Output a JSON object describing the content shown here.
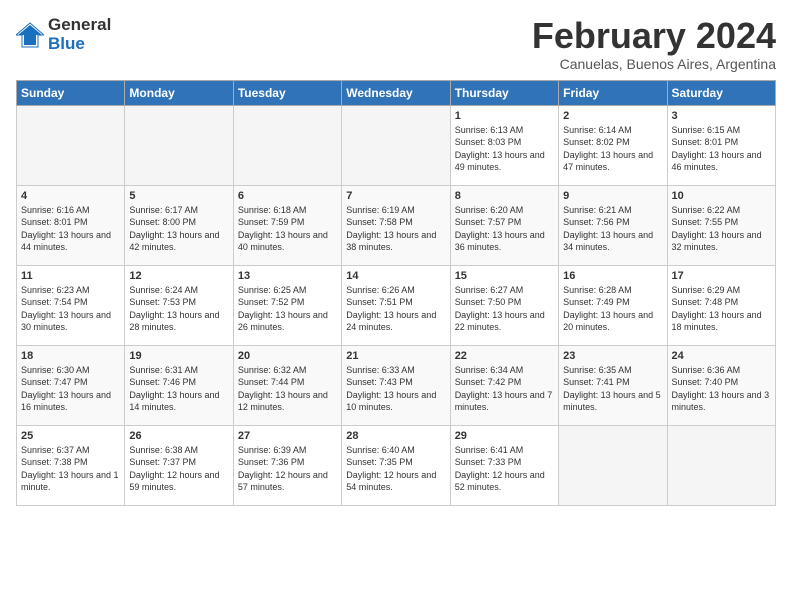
{
  "logo": {
    "general": "General",
    "blue": "Blue"
  },
  "title": "February 2024",
  "location": "Canuelas, Buenos Aires, Argentina",
  "days_of_week": [
    "Sunday",
    "Monday",
    "Tuesday",
    "Wednesday",
    "Thursday",
    "Friday",
    "Saturday"
  ],
  "weeks": [
    [
      {
        "day": "",
        "info": ""
      },
      {
        "day": "",
        "info": ""
      },
      {
        "day": "",
        "info": ""
      },
      {
        "day": "",
        "info": ""
      },
      {
        "day": "1",
        "info": "Sunrise: 6:13 AM\nSunset: 8:03 PM\nDaylight: 13 hours and 49 minutes."
      },
      {
        "day": "2",
        "info": "Sunrise: 6:14 AM\nSunset: 8:02 PM\nDaylight: 13 hours and 47 minutes."
      },
      {
        "day": "3",
        "info": "Sunrise: 6:15 AM\nSunset: 8:01 PM\nDaylight: 13 hours and 46 minutes."
      }
    ],
    [
      {
        "day": "4",
        "info": "Sunrise: 6:16 AM\nSunset: 8:01 PM\nDaylight: 13 hours and 44 minutes."
      },
      {
        "day": "5",
        "info": "Sunrise: 6:17 AM\nSunset: 8:00 PM\nDaylight: 13 hours and 42 minutes."
      },
      {
        "day": "6",
        "info": "Sunrise: 6:18 AM\nSunset: 7:59 PM\nDaylight: 13 hours and 40 minutes."
      },
      {
        "day": "7",
        "info": "Sunrise: 6:19 AM\nSunset: 7:58 PM\nDaylight: 13 hours and 38 minutes."
      },
      {
        "day": "8",
        "info": "Sunrise: 6:20 AM\nSunset: 7:57 PM\nDaylight: 13 hours and 36 minutes."
      },
      {
        "day": "9",
        "info": "Sunrise: 6:21 AM\nSunset: 7:56 PM\nDaylight: 13 hours and 34 minutes."
      },
      {
        "day": "10",
        "info": "Sunrise: 6:22 AM\nSunset: 7:55 PM\nDaylight: 13 hours and 32 minutes."
      }
    ],
    [
      {
        "day": "11",
        "info": "Sunrise: 6:23 AM\nSunset: 7:54 PM\nDaylight: 13 hours and 30 minutes."
      },
      {
        "day": "12",
        "info": "Sunrise: 6:24 AM\nSunset: 7:53 PM\nDaylight: 13 hours and 28 minutes."
      },
      {
        "day": "13",
        "info": "Sunrise: 6:25 AM\nSunset: 7:52 PM\nDaylight: 13 hours and 26 minutes."
      },
      {
        "day": "14",
        "info": "Sunrise: 6:26 AM\nSunset: 7:51 PM\nDaylight: 13 hours and 24 minutes."
      },
      {
        "day": "15",
        "info": "Sunrise: 6:27 AM\nSunset: 7:50 PM\nDaylight: 13 hours and 22 minutes."
      },
      {
        "day": "16",
        "info": "Sunrise: 6:28 AM\nSunset: 7:49 PM\nDaylight: 13 hours and 20 minutes."
      },
      {
        "day": "17",
        "info": "Sunrise: 6:29 AM\nSunset: 7:48 PM\nDaylight: 13 hours and 18 minutes."
      }
    ],
    [
      {
        "day": "18",
        "info": "Sunrise: 6:30 AM\nSunset: 7:47 PM\nDaylight: 13 hours and 16 minutes."
      },
      {
        "day": "19",
        "info": "Sunrise: 6:31 AM\nSunset: 7:46 PM\nDaylight: 13 hours and 14 minutes."
      },
      {
        "day": "20",
        "info": "Sunrise: 6:32 AM\nSunset: 7:44 PM\nDaylight: 13 hours and 12 minutes."
      },
      {
        "day": "21",
        "info": "Sunrise: 6:33 AM\nSunset: 7:43 PM\nDaylight: 13 hours and 10 minutes."
      },
      {
        "day": "22",
        "info": "Sunrise: 6:34 AM\nSunset: 7:42 PM\nDaylight: 13 hours and 7 minutes."
      },
      {
        "day": "23",
        "info": "Sunrise: 6:35 AM\nSunset: 7:41 PM\nDaylight: 13 hours and 5 minutes."
      },
      {
        "day": "24",
        "info": "Sunrise: 6:36 AM\nSunset: 7:40 PM\nDaylight: 13 hours and 3 minutes."
      }
    ],
    [
      {
        "day": "25",
        "info": "Sunrise: 6:37 AM\nSunset: 7:38 PM\nDaylight: 13 hours and 1 minute."
      },
      {
        "day": "26",
        "info": "Sunrise: 6:38 AM\nSunset: 7:37 PM\nDaylight: 12 hours and 59 minutes."
      },
      {
        "day": "27",
        "info": "Sunrise: 6:39 AM\nSunset: 7:36 PM\nDaylight: 12 hours and 57 minutes."
      },
      {
        "day": "28",
        "info": "Sunrise: 6:40 AM\nSunset: 7:35 PM\nDaylight: 12 hours and 54 minutes."
      },
      {
        "day": "29",
        "info": "Sunrise: 6:41 AM\nSunset: 7:33 PM\nDaylight: 12 hours and 52 minutes."
      },
      {
        "day": "",
        "info": ""
      },
      {
        "day": "",
        "info": ""
      }
    ]
  ]
}
